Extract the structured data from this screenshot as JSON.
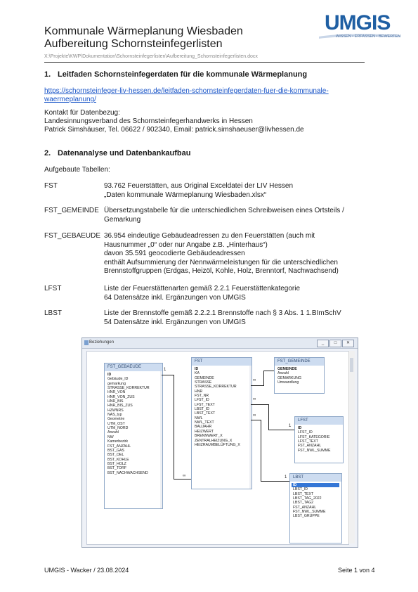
{
  "header": {
    "title_line1": "Kommunale Wärmeplanung Wiesbaden",
    "title_line2": "Aufbereitung Schornsteinfegerlisten",
    "file_path": "X:\\Projekte\\KWP\\Dokumentation\\Schornsteinfegerlisten\\Aufbereitung_Schornsteinfegerlisten.docx",
    "logo_name": "UMGIS",
    "logo_tagline": "WISSEN • ERFASSEN • BEWERTEN"
  },
  "section1": {
    "heading_num": "1.",
    "heading_text": "Leitfaden Schornsteinfegerdaten für die kommunale Wärmeplanung",
    "link_line1": "https://schornsteinfeger-liv-hessen.de/leitfaden-schornsteinfegerdaten-fuer-die-kommunale-",
    "link_line2": "waermeplanung/",
    "contact_label": "Kontakt für Datenbezug:",
    "contact_org": "Landesinnungsverband des Schornsteinfegerhandwerks in Hessen",
    "contact_person": "Patrick Simshäuser, Tel. 06622 / 902340, Email: patrick.simshaeuser@livhessen.de"
  },
  "section2": {
    "heading_num": "2.",
    "heading_text": "Datenanalyse und Datenbankaufbau",
    "intro": "Aufgebaute Tabellen:",
    "tables": [
      {
        "name": "FST",
        "lines": [
          "93.762 Feuerstätten, aus Original Exceldatei der LIV Hessen",
          "„Daten kommunale Wärmeplanung Wiesbaden.xlsx“"
        ]
      },
      {
        "name": "FST_GEMEINDE",
        "lines": [
          "Übersetzungstabelle für die unterschiedlichen Schreibweisen eines Ortsteils /",
          "Gemarkung"
        ]
      },
      {
        "name": "FST_GEBAEUDE",
        "lines": [
          "36.954 eindeutige Gebäudeadressen zu den Feuerstätten (auch mit",
          "Hausnummer „0“ oder nur Angabe z.B. „Hinterhaus“)",
          "davon 35.591 geocodierte Gebäudeadressen",
          "enthält Aufsummierung der Nennwärmeleistungen für die unterschiedlichen",
          "Brennstoffgruppen (Erdgas, Heizöl, Kohle, Holz, Brenntorf, Nachwachsend)"
        ]
      },
      {
        "name": "LFST",
        "lines": [
          "Liste der Feuerstättenarten gemäß 2.2.1 Feuerstättenkategorie",
          "64 Datensätze inkl. Ergänzungen von UMGIS"
        ]
      },
      {
        "name": "LBST",
        "lines": [
          "Liste der Brennstoffe gemäß 2.2.2.1 Brennstoffe nach § 3 Abs. 1 1.BImSchV",
          "54 Datensätze inkl. Ergänzungen von UMGIS"
        ]
      }
    ]
  },
  "db_window": {
    "title": "Beziehungen",
    "buttons": [
      "_",
      "□",
      "✕"
    ],
    "tables": {
      "gebaeude": {
        "title": "FST_GEBAEUDE",
        "fields": [
          "ID",
          "Gebäude_ID",
          "gemarkung",
          "STRASSE_KORREKTUR",
          "HNR_VON",
          "HNR_VON_ZUS",
          "HNR_BIS",
          "HNR_BIS_ZUS",
          "HZWNRS",
          "NAS_typ",
          "Geometrie",
          "UTM_OST",
          "UTM_NORD",
          "Anzahl",
          "NW",
          "Kamerbezirk",
          "FST_ANZAHL",
          "BST_GAS",
          "BST_OEL",
          "BST_KOHLE",
          "BST_HOLZ",
          "BST_TORF",
          "BST_NACHWACHSEND"
        ]
      },
      "fst": {
        "title": "FST",
        "fields": [
          "ID",
          "KA",
          "GEMEINDE",
          "STRASSE",
          "STRASSE_KORREKTUR",
          "HNR",
          "FST_NR",
          "LFST_ID",
          "LFST_TEXT",
          "LBST_ID",
          "LBST_TEXT",
          "NWL",
          "NWL_TEXT",
          "BAUJAHR",
          "HEIZWERT",
          "BRENNWERT_X",
          "ZENTRALHEIZUNG_X",
          "HEIZRAUMBELÜFTUNG_X"
        ]
      },
      "gemeinde": {
        "title": "FST_GEMEINDE",
        "fields": [
          "GEMEINDE",
          "Anzahl",
          "GEMARKUNG",
          "Umwandlung"
        ]
      },
      "lfst": {
        "title": "LFST",
        "fields": [
          "ID",
          "LFST_ID",
          "LFST_KATEGORIE",
          "LFST_TEXT",
          "FST_ANZAHL",
          "FST_NWL_SUMME"
        ]
      },
      "lbst": {
        "title": "LBST",
        "fields": [
          "ID",
          "LBST_ID",
          "LBST_TEXT",
          "LBST_TAG_2022",
          "LBST_TAG2",
          "FST_ANZAHL",
          "FST_NWL_SUMME",
          "LBST_GRUPPE"
        ]
      }
    },
    "cardinality": {
      "one": "1",
      "many": "∞"
    }
  },
  "footer": {
    "left": "UMGIS - Wacker / 23.08.2024",
    "right": "Seite 1 von 4"
  },
  "colors": {
    "accent": "#1f5fa3",
    "link": "#1a55c8",
    "table_header": "#cddcf0",
    "selected_field": "#3476d6"
  }
}
